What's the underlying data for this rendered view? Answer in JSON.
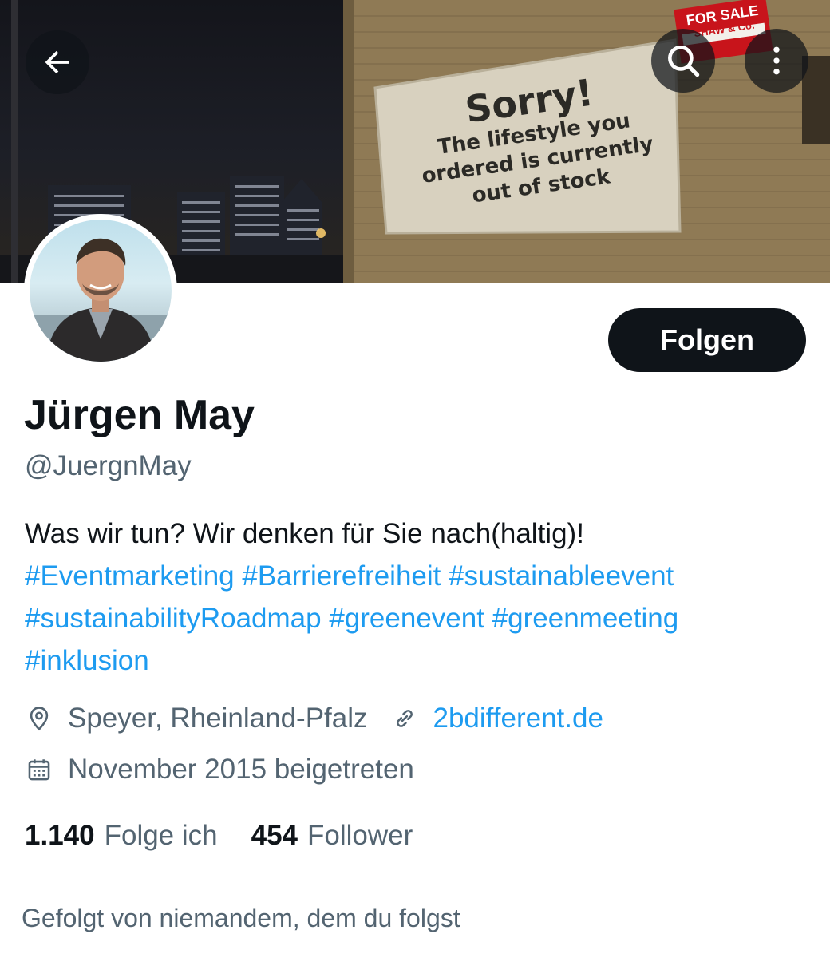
{
  "header": {
    "back_icon": "arrow-left-icon",
    "search_icon": "search-icon",
    "more_icon": "more-vertical-icon",
    "banner_sign": {
      "title": "Sorry!",
      "line1": "The lifestyle you",
      "line2": "ordered is currently",
      "line3": "out of stock"
    },
    "banner_forsale": {
      "line1": "FOR SALE",
      "line2": "SHAW & Co."
    }
  },
  "profile": {
    "name": "Jürgen May",
    "handle": "@JuergnMay",
    "follow_label": "Folgen",
    "bio": {
      "text": "Was wir tun? Wir denken für Sie nach(haltig)!",
      "hashtags": [
        "#Eventmarketing",
        "#Barrierefreiheit",
        "#sustainableevent",
        "#sustainabilityRoadmap",
        "#greenevent",
        "#greenmeeting",
        "#inklusion"
      ]
    },
    "location": "Speyer, Rheinland-Pfalz",
    "website": "2bdifferent.de",
    "joined": "November 2015 beigetreten",
    "stats": {
      "following_count": "1.140",
      "following_label": "Folge ich",
      "followers_count": "454",
      "followers_label": "Follower"
    },
    "followed_by": "Gefolgt von niemandem, dem du folgst"
  },
  "colors": {
    "accent": "#1d9bf0",
    "text": "#0f1419",
    "secondary": "#536471"
  }
}
